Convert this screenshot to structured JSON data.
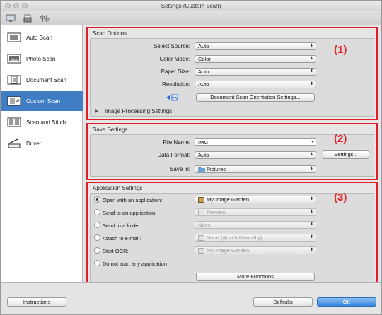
{
  "window": {
    "title": "Settings (Custom Scan)"
  },
  "toolbar": {
    "icons": [
      "scan-from-computer-icon",
      "scan-from-operation-panel-icon",
      "general-settings-icon"
    ]
  },
  "sidebar": {
    "items": [
      {
        "label": "Auto Scan",
        "icon": "auto-scan-icon",
        "selected": false
      },
      {
        "label": "Photo Scan",
        "icon": "photo-scan-icon",
        "selected": false
      },
      {
        "label": "Document Scan",
        "icon": "document-scan-icon",
        "selected": false
      },
      {
        "label": "Custom Scan",
        "icon": "custom-scan-icon",
        "selected": true
      },
      {
        "label": "Scan and Stitch",
        "icon": "scan-stitch-icon",
        "selected": false
      },
      {
        "label": "Driver",
        "icon": "driver-icon",
        "selected": false
      }
    ]
  },
  "scan_options": {
    "title": "Scan Options",
    "tag": "(1)",
    "select_source": {
      "label": "Select Source:",
      "value": "Auto"
    },
    "color_mode": {
      "label": "Color Mode:",
      "value": "Color"
    },
    "paper_size": {
      "label": "Paper Size:",
      "value": "Auto"
    },
    "resolution": {
      "label": "Resolution:",
      "value": "Auto"
    },
    "orientation_button": "Document Scan Orientation Settings...",
    "image_processing": "Image Processing Settings"
  },
  "save_settings": {
    "title": "Save Settings",
    "tag": "(2)",
    "file_name": {
      "label": "File Name:",
      "value": "IMG"
    },
    "data_format": {
      "label": "Data Format:",
      "value": "Auto"
    },
    "settings_button": "Settings...",
    "save_in": {
      "label": "Save in:",
      "value": "Pictures"
    }
  },
  "application_settings": {
    "title": "Application Settings",
    "tag": "(3)",
    "options": [
      {
        "label": "Open with an application:",
        "value": "My Image Garden",
        "selected": true,
        "enabled": true
      },
      {
        "label": "Send to an application:",
        "value": "Preview",
        "selected": false,
        "enabled": false
      },
      {
        "label": "Send to a folder:",
        "value": "None",
        "selected": false,
        "enabled": false
      },
      {
        "label": "Attach to e-mail:",
        "value": "None (Attach Manually)",
        "selected": false,
        "enabled": false
      },
      {
        "label": "Start OCR:",
        "value": "My Image Garden",
        "selected": false,
        "enabled": false
      },
      {
        "label": "Do not start any application",
        "value": "",
        "selected": false,
        "enabled": true
      }
    ],
    "more_functions_button": "More Functions"
  },
  "footer": {
    "instructions": "Instructions",
    "defaults": "Defaults",
    "ok": "OK"
  },
  "colors": {
    "highlight": "#e21f26",
    "selection": "#3f7dc5",
    "primary_button": "#3a86dc"
  }
}
